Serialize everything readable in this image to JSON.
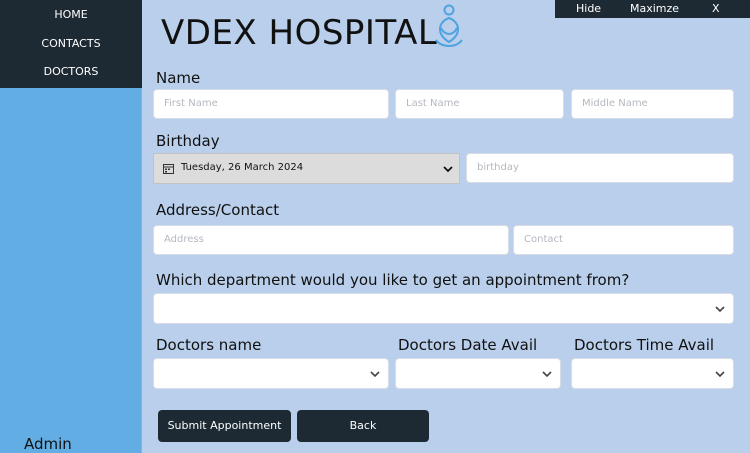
{
  "nav": {
    "home": "HOME",
    "contacts": "CONTACTS",
    "doctors": "DOCTORS"
  },
  "sidebar": {
    "user": "Admin"
  },
  "window": {
    "hide": "Hide",
    "maximize": "Maximze",
    "close": "X"
  },
  "header": {
    "title": "VDEX HOSPITAL",
    "logo_icon": "person-heart-logo-icon"
  },
  "form": {
    "name_label": "Name",
    "first_name_placeholder": "First Name",
    "last_name_placeholder": "Last Name",
    "middle_name_placeholder": "Middle Name",
    "birthday_label": "Birthday",
    "birthday_date_value": "Tuesday, 26 March 2024",
    "birthday_placeholder": "birthday",
    "address_label": "Address/Contact",
    "address_placeholder": "Address",
    "contact_placeholder": "Contact",
    "department_label": "Which department would you like to get an appointment from?",
    "doctors_name_label": "Doctors name",
    "doctors_date_label": "Doctors Date Avail",
    "doctors_time_label": "Doctors Time Avail",
    "submit_label": "Submit Appointment",
    "back_label": "Back"
  },
  "colors": {
    "dark": "#1e2a33",
    "sidebar": "#62aee4",
    "background": "#b9cfeb",
    "logo": "#4fa3e0"
  }
}
